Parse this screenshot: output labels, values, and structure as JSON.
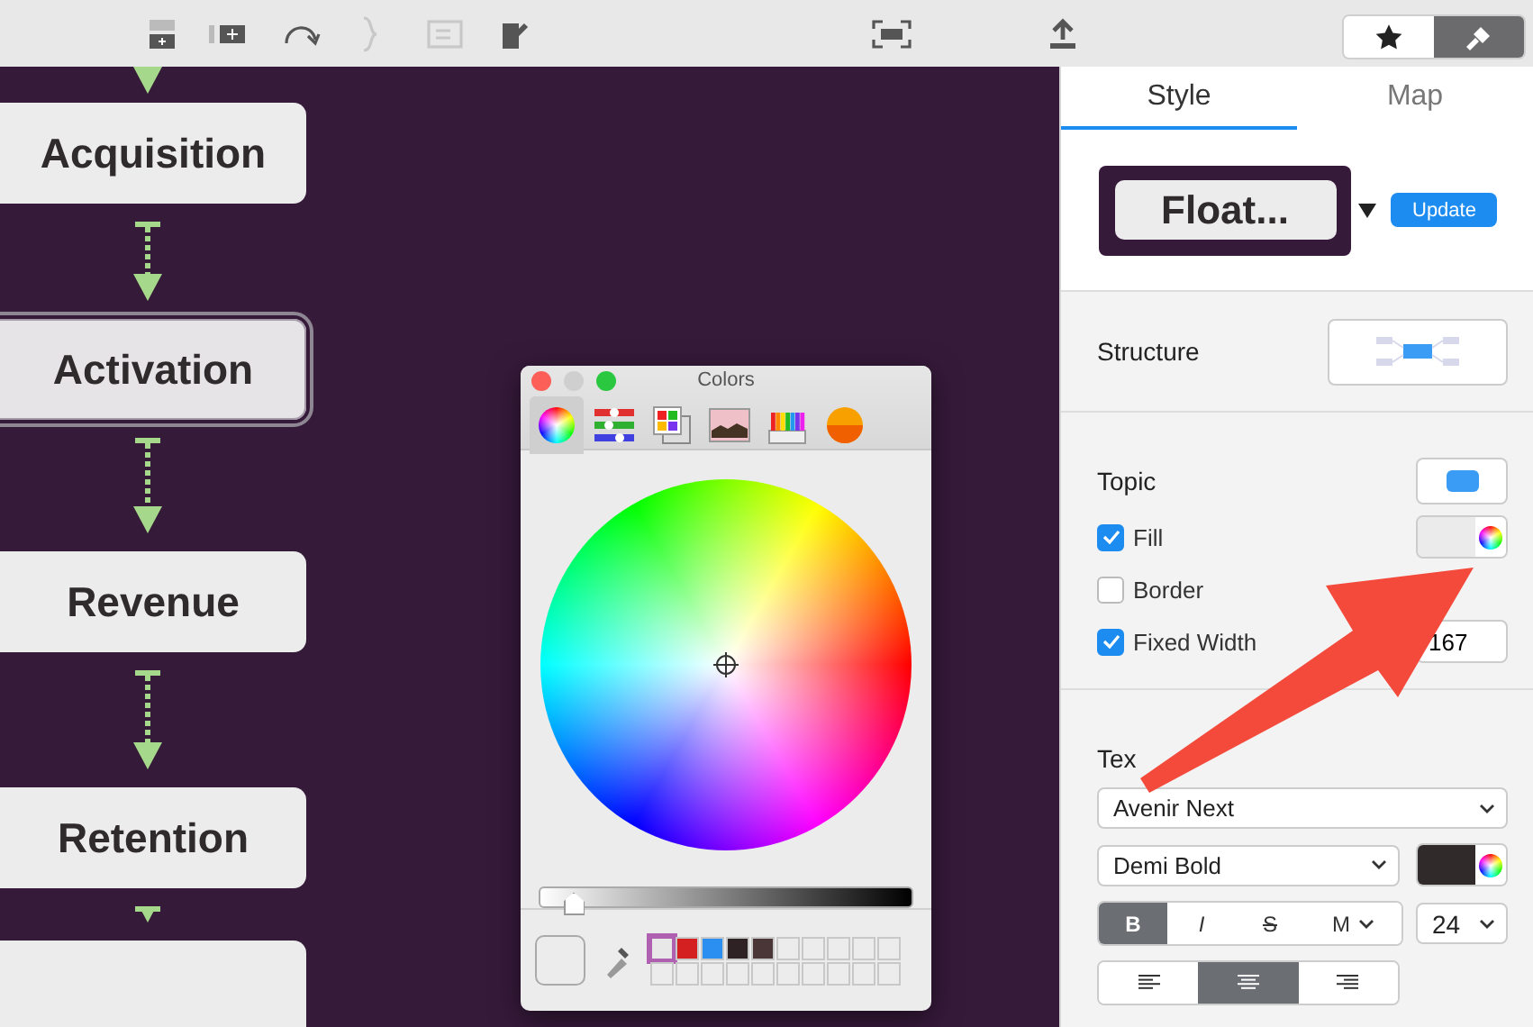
{
  "toolbar": {
    "tools": [
      {
        "kind": "insert-before",
        "disabled": false
      },
      {
        "kind": "insert-child",
        "disabled": false
      },
      {
        "kind": "relationship",
        "disabled": false
      },
      {
        "kind": "boundary",
        "disabled": true
      },
      {
        "kind": "summary",
        "disabled": true
      },
      {
        "kind": "note",
        "disabled": false
      },
      {
        "kind": "focus",
        "disabled": false
      },
      {
        "kind": "share",
        "disabled": false
      }
    ],
    "modes": [
      {
        "kind": "star",
        "selected": false
      },
      {
        "kind": "brush",
        "selected": true
      }
    ]
  },
  "canvas": {
    "nodes": [
      {
        "label": "Acquisition",
        "selected": false
      },
      {
        "label": "Activation",
        "selected": true
      },
      {
        "label": "Revenue",
        "selected": false
      },
      {
        "label": "Retention",
        "selected": false
      },
      {
        "selected": false
      }
    ]
  },
  "colors_window": {
    "title": "Colors",
    "tabs": [
      {
        "kind": "wheel",
        "selected": true
      },
      {
        "kind": "sliders",
        "selected": false
      },
      {
        "kind": "palettes",
        "selected": false
      },
      {
        "kind": "image",
        "selected": false
      },
      {
        "kind": "pencils",
        "selected": false
      },
      {
        "kind": "sphere",
        "selected": false
      }
    ],
    "brightness": {
      "level": 0.09
    },
    "swatches": [
      {
        "color": "#e8e8e8",
        "selected": true
      },
      {
        "color": "#d42020",
        "selected": false
      },
      {
        "color": "#2a8ff0",
        "selected": false
      },
      {
        "color": "#2e2224",
        "selected": false
      },
      {
        "color": "#4a3636",
        "selected": false
      }
    ]
  },
  "sidebar": {
    "tabs": [
      {
        "label": "Style",
        "selected": true
      },
      {
        "label": "Map",
        "selected": false
      }
    ],
    "preview": {
      "label": "Float...",
      "button": "Update"
    },
    "structure": {
      "label": "Structure"
    },
    "topic": {
      "label": "Topic",
      "options": [
        {
          "label": "Fill",
          "checked": true
        },
        {
          "label": "Border",
          "checked": false
        },
        {
          "label": "Fixed Width",
          "checked": true,
          "value": "167"
        }
      ]
    },
    "text": {
      "label": "Tex",
      "font": "Avenir Next",
      "weight": "Demi Bold",
      "size": "24",
      "styles": [
        {
          "label": "B",
          "selected": true
        },
        {
          "label": "I",
          "selected": false
        },
        {
          "label": "S",
          "selected": false
        },
        {
          "label": "M",
          "selected": false
        }
      ],
      "align": [
        {
          "kind": "left",
          "selected": false
        },
        {
          "kind": "center",
          "selected": true
        },
        {
          "kind": "right",
          "selected": false
        }
      ]
    }
  }
}
